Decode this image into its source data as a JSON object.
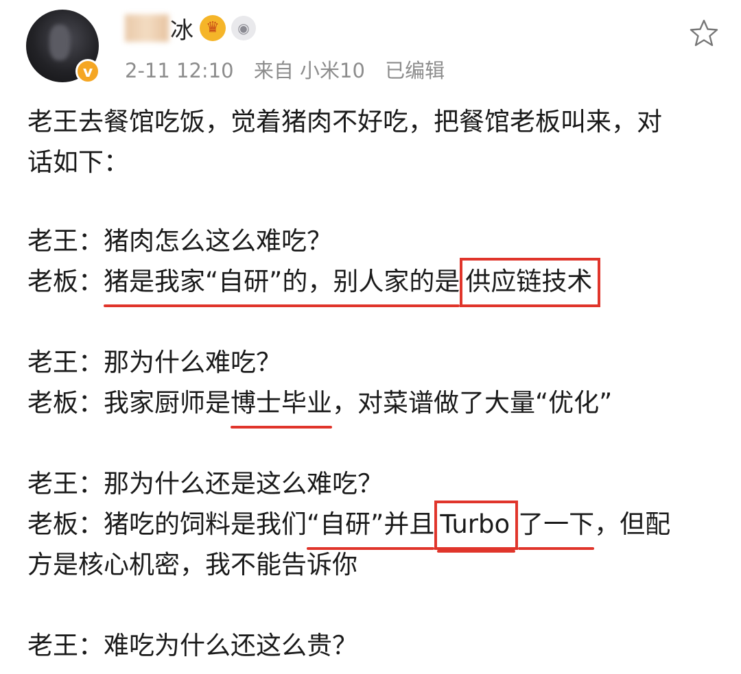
{
  "header": {
    "username": "冰",
    "vip_icon": "crown-icon",
    "level_icon": "level-badge-icon",
    "verified_icon": "verified-v-icon",
    "verified_glyph": "v",
    "time": "2-11 12:10",
    "source": "来自 小米10",
    "edited": "已编辑",
    "star_icon": "favorite-star-icon"
  },
  "post": {
    "intro_1": "老王去餐馆吃饭，觉着猪肉不好吃，把餐馆老板叫来，对",
    "intro_2": "话如下：",
    "q1": "老王：猪肉怎么这么难吃？",
    "a1_prefix": "老板：",
    "a1_underlined": "猪是我家“自研”的，别人家的是",
    "a1_boxed": "供应链技术",
    "q2": "老王：那为什么难吃？",
    "a2_prefix": "老板：我家厨师是",
    "a2_underlined": "博士毕业",
    "a2_suffix": "，对菜谱做了大量“优化”",
    "q3": "老王：那为什么还是这么难吃？",
    "a3_prefix": "老板：猪吃的饲料是我们",
    "a3_underlined_1": "“自研”并且",
    "a3_boxed": "Turbo",
    "a3_underlined_2": "了一下",
    "a3_suffix": "，但配",
    "a3_line2": "方是核心机密，我不能告诉你",
    "q4": "老王：难吃为什么还这么贵？"
  },
  "colors": {
    "highlight": "#e0352b",
    "meta_text": "#8c8c8c",
    "body_text": "#1a1a1a",
    "vip_gold": "#f5b529"
  }
}
